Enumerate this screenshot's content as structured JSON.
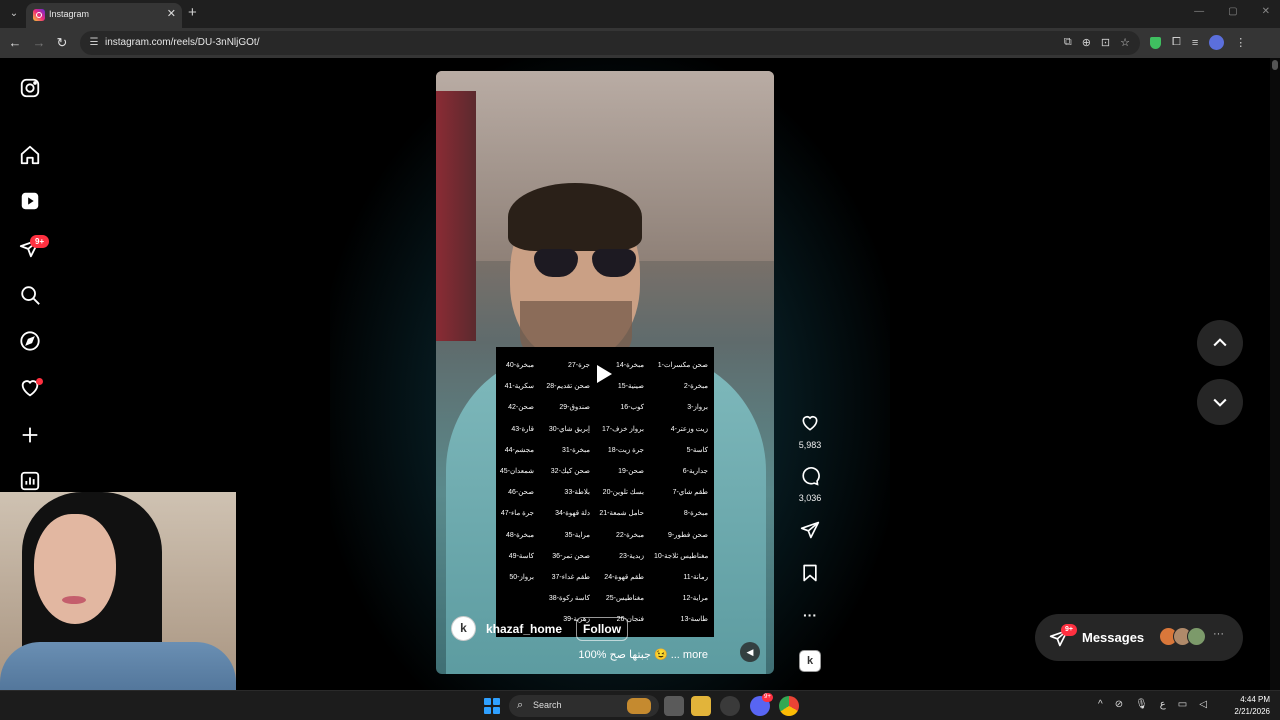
{
  "browser": {
    "tab_title": "Instagram",
    "tab_close": "✕",
    "new_tab": "+",
    "url": "instagram.com/reels/DU-3nNljGOt/"
  },
  "sidebar": {
    "notifications_badge": "9+"
  },
  "reel": {
    "username": "khazaf_home",
    "follow_label": "Follow",
    "caption": "100% جبتها صح 😉 ... more",
    "avatar_letter": "k",
    "list_columns": [
      [
        "1-صحن مكسرات",
        "2-مبخرة",
        "3-برواز",
        "4-زيت وزعتر",
        "5-كاسة",
        "6-جدارية",
        "7-طقم شاي",
        "8-مبخرة",
        "9-صحن فطور",
        "10-مغناطيس ثلاجة",
        "11-رمانة",
        "12-مراية",
        "13-طاسة"
      ],
      [
        "14-مبخرة",
        "15-صينية",
        "16-كوب",
        "17-برواز خزف",
        "18-جرة زيت",
        "19-صحن",
        "20-بسك تلوين",
        "21-حامل شمعة",
        "22-مبخرة",
        "23-زبدية",
        "24-طقم قهوة",
        "25-مغناطيس",
        "26-فنجان"
      ],
      [
        "27-جرة",
        "28-صحن تقديم",
        "29-صندوق",
        "30-إبريق شاي",
        "31-مبخرة",
        "32-صحن كيك",
        "33-بلاطة",
        "34-دلة قهوة",
        "35-مراية",
        "36-صحن تمر",
        "37-طقم غداء",
        "38-كاسة ركوة",
        "39-زهرية"
      ],
      [
        "40-مبخرة",
        "41-سكرية",
        "42-صحن",
        "43-قارة",
        "44-مجشم",
        "45-شمعدان",
        "46-صحن",
        "47-جرة ماء",
        "48-مبخرة",
        "49-كاسة",
        "50-برواز"
      ]
    ],
    "likes": "5,983",
    "comments": "3,036"
  },
  "messages": {
    "label": "Messages",
    "badge": "9+"
  },
  "taskbar": {
    "search_label": "Search",
    "time": "4:44 PM",
    "date": "2/21/2026",
    "discord_badge": "9+",
    "tray_lang": "ع"
  }
}
